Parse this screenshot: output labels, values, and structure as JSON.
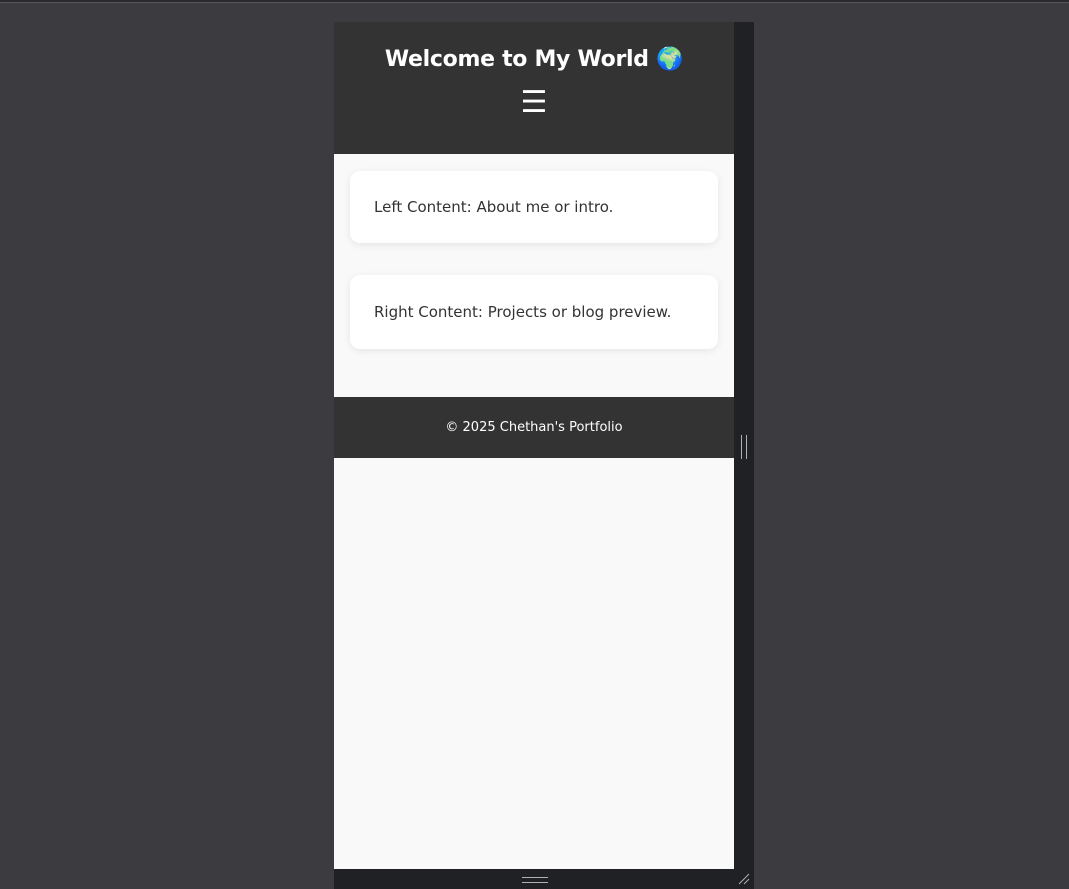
{
  "header": {
    "title": "Welcome to My World 🌍",
    "menu_icon": "☰"
  },
  "main": {
    "cards": [
      {
        "text": "Left Content: About me or intro."
      },
      {
        "text": "Right Content: Projects or blog preview."
      }
    ]
  },
  "footer": {
    "text": "© 2025 Chethan's Portfolio"
  },
  "colors": {
    "header_bg": "#333333",
    "page_bg": "#f9f9f9",
    "card_bg": "#ffffff",
    "devtools_bg": "#3b3b40"
  }
}
